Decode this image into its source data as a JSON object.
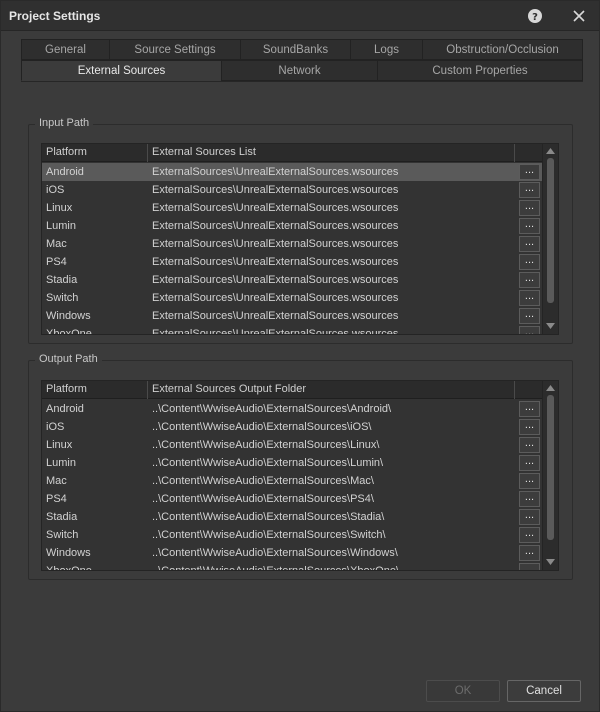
{
  "window": {
    "title": "Project Settings"
  },
  "icons": {
    "help": "help-icon",
    "close": "close-icon"
  },
  "tabs": {
    "row1": [
      "General",
      "Source Settings",
      "SoundBanks",
      "Logs",
      "Obstruction/Occlusion"
    ],
    "row2": [
      "External Sources",
      "Network",
      "Custom Properties"
    ],
    "active": "External Sources"
  },
  "input_path": {
    "legend": "Input Path",
    "columns": [
      "Platform",
      "External Sources List"
    ],
    "rows": [
      {
        "platform": "Android",
        "path": "ExternalSources\\UnrealExternalSources.wsources",
        "selected": true
      },
      {
        "platform": "iOS",
        "path": "ExternalSources\\UnrealExternalSources.wsources"
      },
      {
        "platform": "Linux",
        "path": "ExternalSources\\UnrealExternalSources.wsources"
      },
      {
        "platform": "Lumin",
        "path": "ExternalSources\\UnrealExternalSources.wsources"
      },
      {
        "platform": "Mac",
        "path": "ExternalSources\\UnrealExternalSources.wsources"
      },
      {
        "platform": "PS4",
        "path": "ExternalSources\\UnrealExternalSources.wsources"
      },
      {
        "platform": "Stadia",
        "path": "ExternalSources\\UnrealExternalSources.wsources"
      },
      {
        "platform": "Switch",
        "path": "ExternalSources\\UnrealExternalSources.wsources"
      },
      {
        "platform": "Windows",
        "path": "ExternalSources\\UnrealExternalSources.wsources"
      },
      {
        "platform": "XboxOne",
        "path": "ExternalSources\\UnrealExternalSources.wsources"
      }
    ]
  },
  "output_path": {
    "legend": "Output Path",
    "columns": [
      "Platform",
      "External Sources Output Folder"
    ],
    "rows": [
      {
        "platform": "Android",
        "path": "..\\Content\\WwiseAudio\\ExternalSources\\Android\\"
      },
      {
        "platform": "iOS",
        "path": "..\\Content\\WwiseAudio\\ExternalSources\\iOS\\"
      },
      {
        "platform": "Linux",
        "path": "..\\Content\\WwiseAudio\\ExternalSources\\Linux\\"
      },
      {
        "platform": "Lumin",
        "path": "..\\Content\\WwiseAudio\\ExternalSources\\Lumin\\"
      },
      {
        "platform": "Mac",
        "path": "..\\Content\\WwiseAudio\\ExternalSources\\Mac\\"
      },
      {
        "platform": "PS4",
        "path": "..\\Content\\WwiseAudio\\ExternalSources\\PS4\\"
      },
      {
        "platform": "Stadia",
        "path": "..\\Content\\WwiseAudio\\ExternalSources\\Stadia\\"
      },
      {
        "platform": "Switch",
        "path": "..\\Content\\WwiseAudio\\ExternalSources\\Switch\\"
      },
      {
        "platform": "Windows",
        "path": "..\\Content\\WwiseAudio\\ExternalSources\\Windows\\"
      },
      {
        "platform": "XboxOne",
        "path": "..\\Content\\WwiseAudio\\ExternalSources\\XboxOne\\"
      }
    ]
  },
  "browse_label": "...",
  "buttons": {
    "ok": "OK",
    "ok_enabled": false,
    "cancel": "Cancel"
  },
  "colors": {
    "background": "#3b3b3b",
    "selected_row": "#5a5a5a",
    "titlebar": "#303030"
  }
}
